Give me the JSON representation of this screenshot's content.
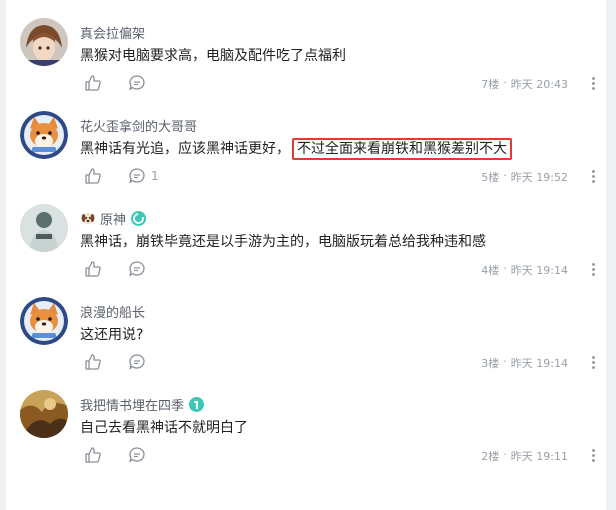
{
  "comments": [
    {
      "username": "真会拉偏架",
      "text": "黑猴对电脑要求高，电脑及配件吃了点福利",
      "text_highlight": "",
      "reply_count": "",
      "floor": "7楼",
      "time": "昨天 20:43",
      "avatar": "anime-character-avatar"
    },
    {
      "username": "花火歪拿剑的大哥哥",
      "text": "黑神话有光追，应该黑神话更好，",
      "text_highlight": "不过全面来看崩铁和黑猴差别不大",
      "reply_count": "1",
      "floor": "5楼",
      "time": "昨天 19:52",
      "avatar": "shiba-dog-avatar"
    },
    {
      "username": "原神",
      "text": "黑神话，崩铁毕竟还是以手游为主的，电脑版玩着总给我种违和感",
      "text_highlight": "",
      "reply_count": "",
      "floor": "4楼",
      "time": "昨天 19:14",
      "avatar": "character-figure-avatar"
    },
    {
      "username": "浪漫的船长",
      "text": "这还用说?",
      "text_highlight": "",
      "reply_count": "",
      "floor": "3楼",
      "time": "昨天 19:14",
      "avatar": "shiba-dog-avatar"
    },
    {
      "username": "我把情书埋在四季",
      "text": "自己去看黑神话不就明白了",
      "text_highlight": "",
      "reply_count": "",
      "floor": "2楼",
      "time": "昨天 19:11",
      "avatar": "illustration-avatar"
    }
  ],
  "meta_separator": "·",
  "colors": {
    "highlight_border": "#e43b30",
    "meta_text": "#9aa0a8",
    "username": "#5a5f6b",
    "badge_teal": "#3cc8b4"
  }
}
